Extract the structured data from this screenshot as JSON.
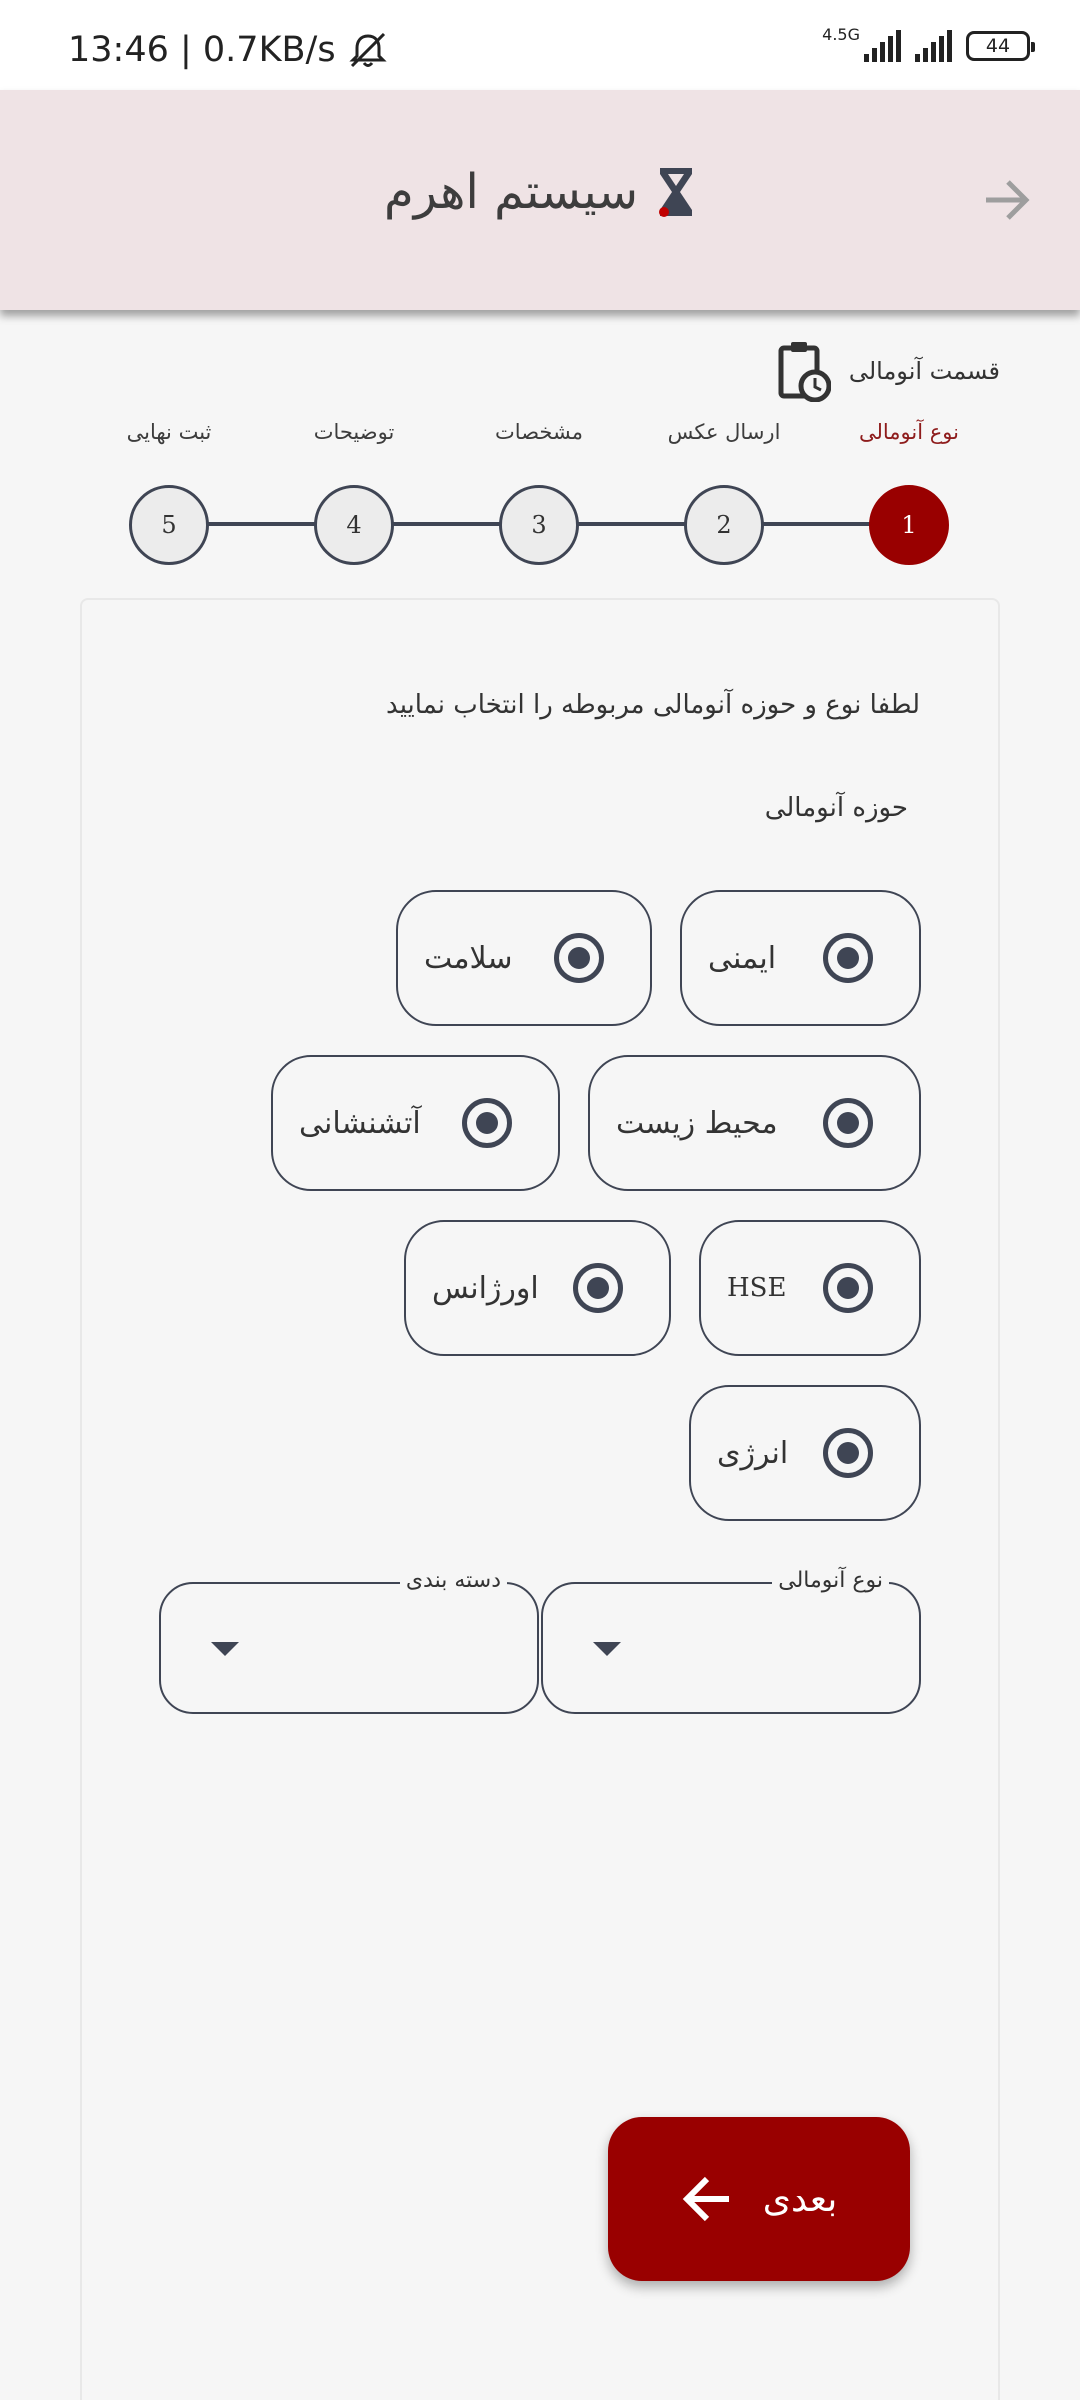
{
  "status_bar": {
    "time_speed": "13:46 | 0.7KB/s",
    "network": "4.5G",
    "battery": "44"
  },
  "header": {
    "title": "سیستم اهرم",
    "back_icon": "arrow-right-icon",
    "logo_icon": "ahram-logo-icon"
  },
  "section": {
    "label": "قسمت آنومالی",
    "icon": "clipboard-clock-icon"
  },
  "stepper": {
    "steps": [
      {
        "number": "1",
        "label": "نوع آنومالی",
        "active": true
      },
      {
        "number": "2",
        "label": "ارسال عکس",
        "active": false
      },
      {
        "number": "3",
        "label": "مشخصات",
        "active": false
      },
      {
        "number": "4",
        "label": "توضیحات",
        "active": false
      },
      {
        "number": "5",
        "label": "ثبت نهایی",
        "active": false
      }
    ]
  },
  "form": {
    "instruction": "لطفا نوع و حوزه آنومالی مربوطه را انتخاب نمایید",
    "field_title": "حوزه آنومالی",
    "options": [
      "ایمنی",
      "سلامت",
      "محیط زیست",
      "آتشنشانی",
      "HSE",
      "اورژانس",
      "انرژی"
    ],
    "anomaly_type_label": "نوع آنومالی",
    "category_label": "دسته بندی"
  },
  "actions": {
    "next_label": "بعدی"
  },
  "colors": {
    "accent": "#990000",
    "appbar": "#efe3e5",
    "outline": "#3f4554",
    "background": "#f6f6f6"
  }
}
